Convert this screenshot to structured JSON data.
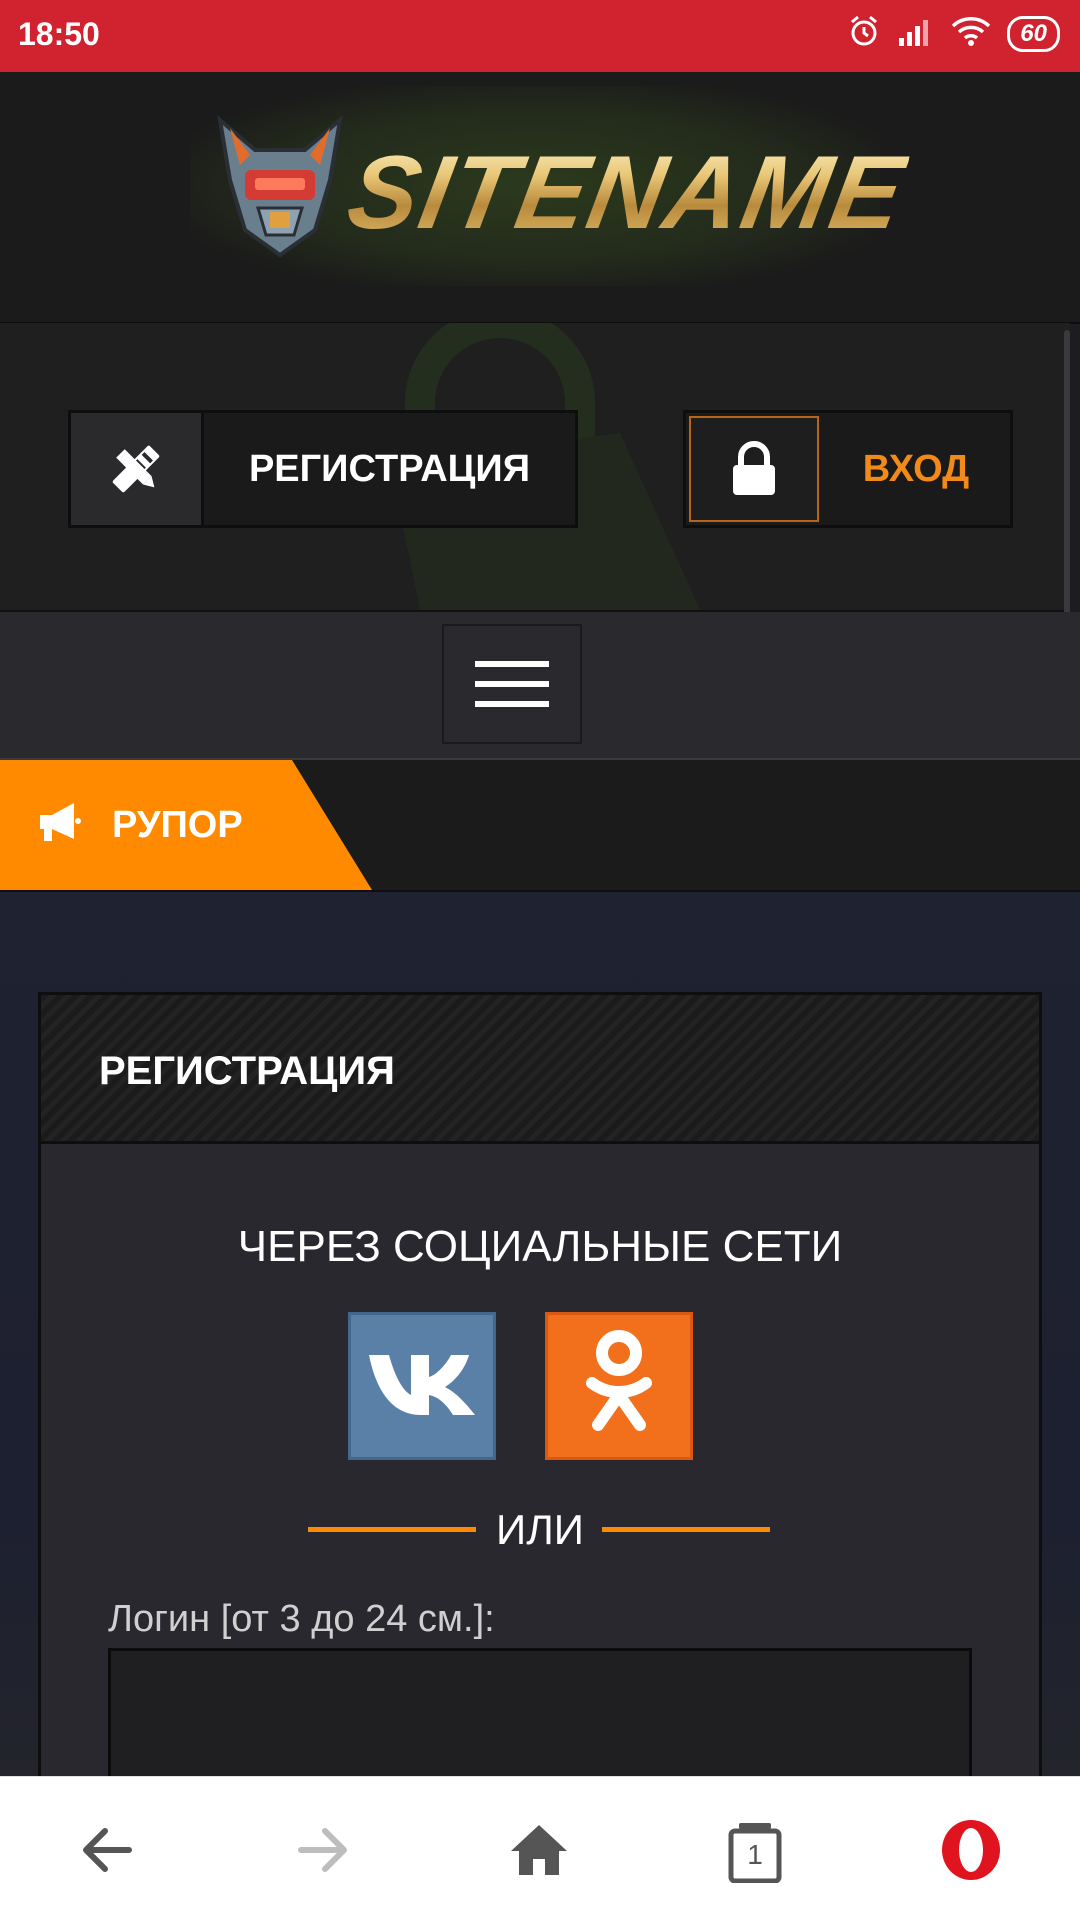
{
  "status_bar": {
    "time": "18:50",
    "battery": "60",
    "icons": [
      "alarm-icon",
      "signal-icon",
      "wifi-icon",
      "battery-icon"
    ]
  },
  "header": {
    "logo_text": "SITENAME"
  },
  "auth": {
    "register_label": "РЕГИСТРАЦИЯ",
    "login_label": "ВХОД"
  },
  "rupor": {
    "label": "РУПОР"
  },
  "card": {
    "title": "РЕГИСТРАЦИЯ",
    "social_title": "ЧЕРЕЗ СОЦИАЛЬНЫЕ СЕТИ",
    "social_buttons": [
      "vk-icon",
      "odnoklassniki-icon"
    ],
    "or_text": "ИЛИ",
    "login_label": "Логин [от  3 до 24 см.]:",
    "login_value": ""
  },
  "bottom_nav": {
    "tab_count": "1",
    "icons": [
      "back-arrow-icon",
      "forward-arrow-icon",
      "home-icon",
      "tabs-icon",
      "opera-icon"
    ]
  },
  "colors": {
    "status_bar": "#d0222f",
    "accent": "#ff8a00",
    "vk": "#5b80a8",
    "ok": "#f26f1b",
    "opera": "#e0141e"
  }
}
